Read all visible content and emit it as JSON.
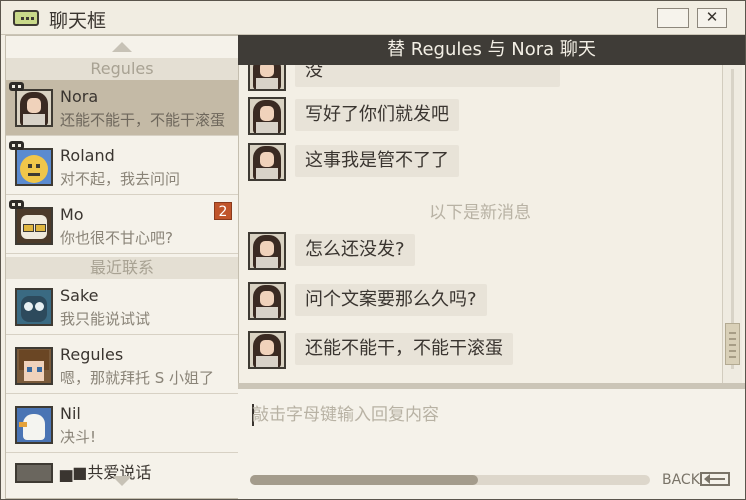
{
  "window": {
    "title": "聊天框",
    "close_label": "✕"
  },
  "sidebar": {
    "sections": [
      {
        "title": "Regules",
        "contacts": [
          {
            "name": "Nora",
            "preview": "还能不能干，不能干滚蛋",
            "active": true,
            "masked": true,
            "unread": "",
            "avatar_icon": "girl-avatar-icon"
          },
          {
            "name": "Roland",
            "preview": "对不起，我去问问",
            "active": false,
            "masked": true,
            "unread": "",
            "avatar_icon": "smiley-avatar-icon"
          },
          {
            "name": "Mo",
            "preview": "你也很不甘心吧?",
            "active": false,
            "masked": true,
            "unread": "2",
            "avatar_icon": "sunglasses-avatar-icon"
          }
        ]
      },
      {
        "title": "最近联系",
        "contacts": [
          {
            "name": "Sake",
            "preview": "我只能说试试",
            "active": false,
            "masked": false,
            "unread": "",
            "avatar_icon": "owl-avatar-icon"
          },
          {
            "name": "Regules",
            "preview": "嗯，那就拜托 S 小姐了",
            "active": false,
            "masked": false,
            "unread": "",
            "avatar_icon": "boy-avatar-icon"
          },
          {
            "name": "Nil",
            "preview": "决斗!",
            "active": false,
            "masked": false,
            "unread": "",
            "avatar_icon": "bird-avatar-icon"
          }
        ]
      }
    ],
    "peek_text": "▅■共爱说话"
  },
  "chat": {
    "header": "替 Regules 与 Nora 聊天",
    "partial_message": "没",
    "messages_before": [
      "写好了你们就发吧",
      "这事我是管不了了"
    ],
    "new_messages_label": "以下是新消息",
    "messages_after": [
      "怎么还没发?",
      "问个文案要那么久吗?",
      "还能不能干，不能干滚蛋"
    ]
  },
  "reply": {
    "placeholder": "敲击字母键输入回复内容",
    "progress": 0.57
  },
  "back_label": "BACK",
  "colors": {
    "header_bg": "#3f3c37",
    "active_contact": "#c4baa6",
    "unread_badge": "#c0552b"
  }
}
